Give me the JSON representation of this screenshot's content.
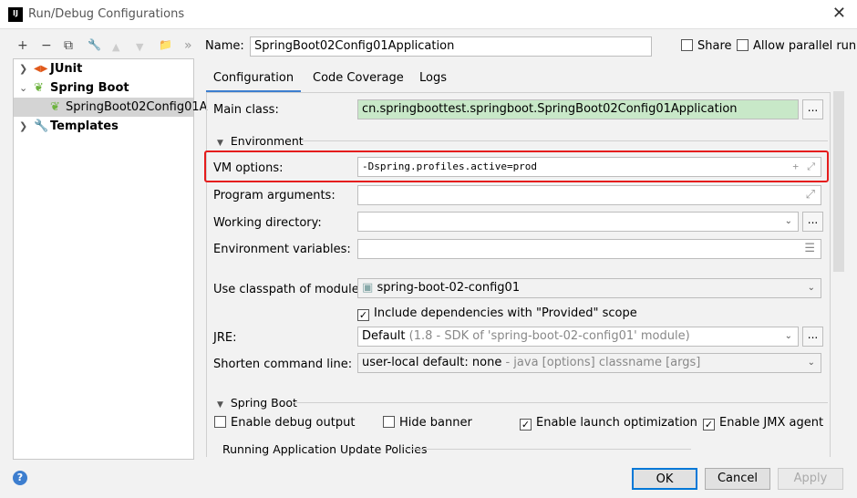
{
  "window": {
    "title": "Run/Debug Configurations",
    "logo": "IJ"
  },
  "toolbar": {
    "add": "+",
    "remove": "−",
    "copy": "⧉",
    "edit": "🔧",
    "up": "▲",
    "down": "▼",
    "folder": "📁",
    "more": "»"
  },
  "tree": [
    {
      "label": "JUnit",
      "icon": "junit-icon"
    },
    {
      "label": "Spring Boot",
      "icon": "spring-boot-icon"
    },
    {
      "label": "SpringBoot02Config01A",
      "icon": "spring-boot-icon"
    },
    {
      "label": "Templates",
      "icon": "wrench-icon"
    }
  ],
  "header": {
    "name_label": "Name:",
    "name_value": "SpringBoot02Config01Application",
    "share": "Share",
    "parallel": "Allow parallel run"
  },
  "tabs": [
    "Configuration",
    "Code Coverage",
    "Logs"
  ],
  "form": {
    "main_class_label": "Main class:",
    "main_class": "cn.springboottest.springboot.SpringBoot02Config01Application",
    "env_section": "Environment",
    "vm_label": "VM options:",
    "vm_value": "-Dspring.profiles.active=prod",
    "prog_label": "Program arguments:",
    "wd_label": "Working directory:",
    "envvars_label": "Environment variables:",
    "module_label": "Use classpath of module:",
    "module_value": "spring-boot-02-config01",
    "include_provided": "Include dependencies with \"Provided\" scope",
    "jre_label": "JRE:",
    "jre_value": "Default",
    "jre_hint": "(1.8 - SDK of 'spring-boot-02-config01' module)",
    "shorten_label": "Shorten command line:",
    "shorten_value": "user-local default: none",
    "shorten_hint": "- java [options] classname [args]",
    "spring_section": "Spring Boot",
    "debug_output": "Enable debug output",
    "hide_banner": "Hide banner",
    "launch_opt": "Enable launch optimization",
    "jmx": "Enable JMX agent",
    "update_policies": "Running Application Update Policies"
  },
  "buttons": {
    "ok": "OK",
    "cancel": "Cancel",
    "apply": "Apply",
    "help": "?"
  },
  "colors": {
    "highlight": "#e51c1c",
    "accent": "#3d7ecf",
    "main_class_bg": "#c8e8c8"
  }
}
